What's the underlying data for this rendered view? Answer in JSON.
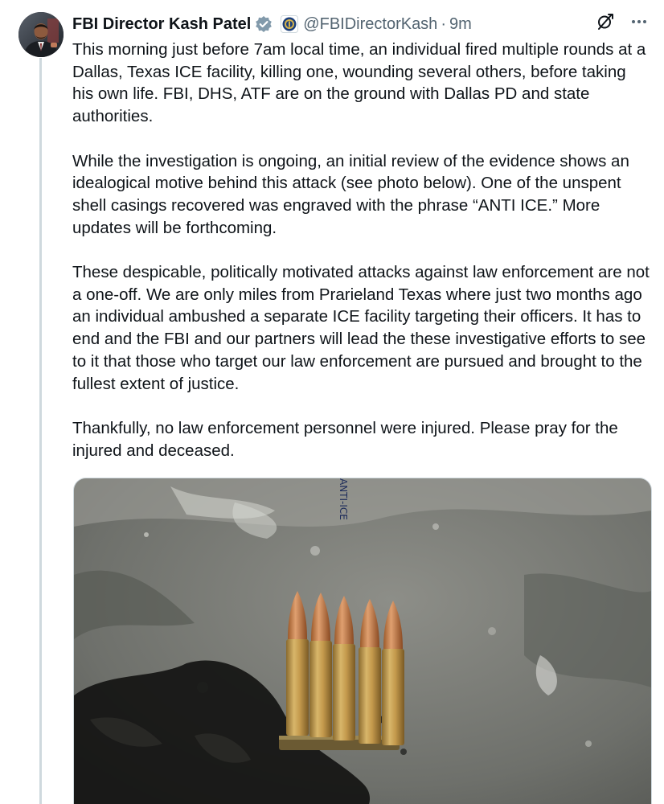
{
  "author": {
    "name": "FBI Director Kash Patel",
    "handle": "@FBIDirectorKash",
    "separator": "·",
    "time": "9m"
  },
  "tweet": {
    "paragraphs": [
      "This morning just before 7am local time, an individual fired multiple rounds at a Dallas, Texas ICE facility, killing one, wounding several others, before taking his own life. FBI, DHS, ATF are on the ground with Dallas PD and state authorities.",
      "While the investigation is ongoing, an initial review of the evidence shows an idealogical motive behind this attack (see photo below). One of the unspent shell casings recovered was engraved with the phrase “ANTI ICE.” More updates will be forthcoming.",
      "These despicable, politically motivated attacks against law enforcement are not a one-off. We are only miles from Prarieland Texas where just two months ago an individual ambushed a separate ICE facility targeting their officers. It has to end and the FBI and our partners will lead the these investigative efforts to see to it that those who target our law enforcement are pursued and brought to the fullest extent of justice.",
      "Thankfully, no law enforcement personnel were injured. Please pray for the injured and deceased."
    ],
    "media_engraving": "ANTI-ICE"
  },
  "icons": {
    "verified": "verified-badge-icon",
    "agency": "fbi-seal-icon",
    "grok": "grok-icon",
    "more": "more-options-icon"
  },
  "colors": {
    "text": "#0f1419",
    "secondary": "#536471",
    "verified": "#1d9bf0",
    "thread_line": "#cfd9de"
  }
}
